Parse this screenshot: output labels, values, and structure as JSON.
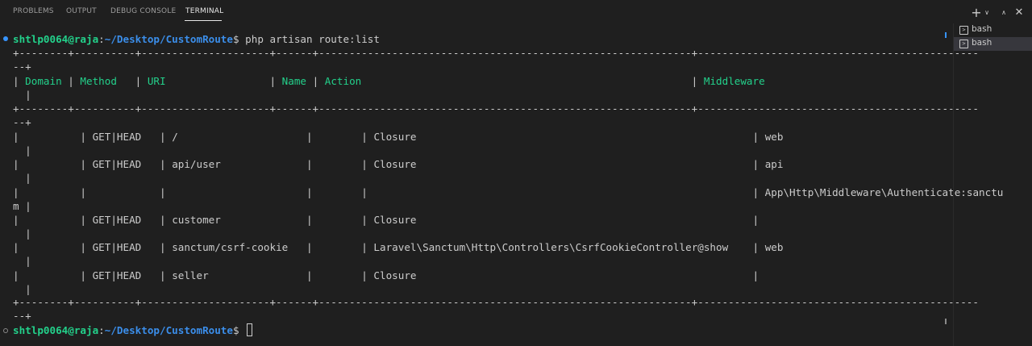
{
  "panel": {
    "tabs": [
      {
        "label": "PROBLEMS"
      },
      {
        "label": "OUTPUT"
      },
      {
        "label": "DEBUG CONSOLE"
      },
      {
        "label": "TERMINAL"
      }
    ],
    "active_tab": "TERMINAL",
    "actions": {
      "new_terminal_icon": "plus-icon",
      "launch_profile_icon": "chevron-down-icon",
      "maximize_icon": "chevron-up-icon",
      "close_icon": "close-icon"
    }
  },
  "terminal": {
    "prompt_user": "shtlp0064@raja",
    "prompt_sep": ":",
    "prompt_path": "~/Desktop/CustomRoute",
    "prompt_symbol": "$",
    "command": " php artisan route:list",
    "border_main": "+--------+----------+---------------------+------+-------------------------------------------------------------+----------------------------------------------",
    "border_wrap": "--+",
    "header": {
      "domain": "Domain",
      "method": "Method",
      "uri": "URI",
      "name": "Name",
      "action": "Action",
      "middleware": "Middleware"
    },
    "header_wrap": "  |",
    "rows": [
      {
        "domain": "",
        "method": "GET|HEAD",
        "uri": "/",
        "name": "",
        "action": "Closure",
        "middleware": "web",
        "wrap": "  |"
      },
      {
        "domain": "",
        "method": "GET|HEAD",
        "uri": "api/user",
        "name": "",
        "action": "Closure",
        "middleware": "api",
        "wrap": "  |"
      },
      {
        "domain": "",
        "method": "",
        "uri": "",
        "name": "",
        "action": "",
        "middleware": "App\\Http\\Middleware\\Authenticate:sanctu",
        "wrap": "m |"
      },
      {
        "domain": "",
        "method": "GET|HEAD",
        "uri": "customer",
        "name": "",
        "action": "Closure",
        "middleware": "",
        "wrap": "  |"
      },
      {
        "domain": "",
        "method": "GET|HEAD",
        "uri": "sanctum/csrf-cookie",
        "name": "",
        "action": "Laravel\\Sanctum\\Http\\Controllers\\CsrfCookieController@show",
        "middleware": "web",
        "wrap": "  |"
      },
      {
        "domain": "",
        "method": "GET|HEAD",
        "uri": "seller",
        "name": "",
        "action": "Closure",
        "middleware": "",
        "wrap": "  |"
      }
    ]
  },
  "terminal_list": [
    {
      "label": "bash",
      "icon": "terminal-icon",
      "active": false
    },
    {
      "label": "bash",
      "icon": "terminal-icon",
      "active": true
    }
  ],
  "colors": {
    "background": "#1f1f1f",
    "prompt_user": "#23d18b",
    "prompt_path": "#3b8eea",
    "table_header": "#23d18b",
    "decoration_success": "#3794ff",
    "active_terminal_item": "#37373d"
  }
}
